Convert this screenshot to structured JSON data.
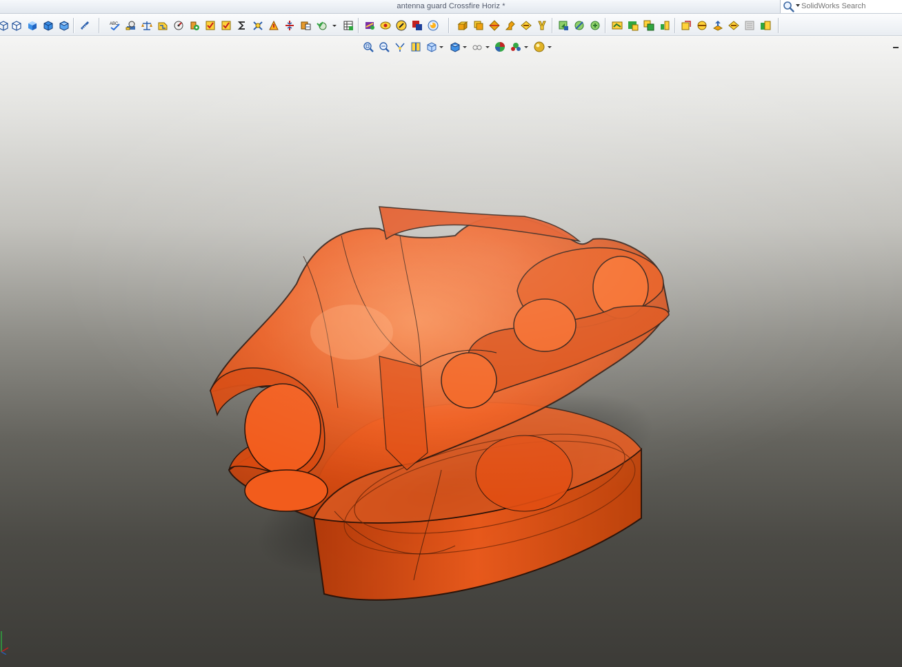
{
  "window": {
    "title": "antenna guard Crossfire Horiz *"
  },
  "search": {
    "placeholder": "SolidWorks Search",
    "icon": "magnifier-icon"
  },
  "colors": {
    "part_orange": "#f05a1a",
    "part_edge": "#2a1208",
    "toolbar_bg": "#eef1f5",
    "viewport_top": "#f5f5f4",
    "viewport_bottom": "#3c3b37"
  },
  "toolbar": {
    "groups": [
      [
        "view-wireframe-icon",
        "view-hidden-lines-icon",
        "view-shaded-icon",
        "view-shaded-edges-icon",
        "view-isometric-icon"
      ],
      [
        "measure-icon"
      ],
      [
        "spell-check-icon",
        "mass-properties-icon",
        "section-properties-icon",
        "check-icon",
        "geometry-analysis-icon",
        "import-diagnostics-icon",
        "deviation-analysis-icon",
        "zebra-stripes-icon",
        "sum-icon",
        "curvature-icon",
        "draft-analysis-icon",
        "undercut-icon",
        "parting-line-icon",
        "thickness-icon",
        "compare-icon"
      ],
      [
        "simulation-icon",
        "rebuild-icon",
        "check-sketch-icon",
        "appearance-icon",
        "realview-icon"
      ],
      [
        "extrude-boss-icon",
        "revolve-icon",
        "sweep-icon",
        "loft-icon",
        "fillet-icon",
        "chamfer-icon"
      ],
      [
        "cut-extrude-icon",
        "cut-revolve-icon",
        "cut-sweep-icon"
      ],
      [
        "plane-icon",
        "axis-icon",
        "coordinate-system-icon",
        "point-icon"
      ],
      [
        "mirror-icon",
        "linear-pattern-icon",
        "circular-pattern-icon",
        "shell-icon",
        "rib-icon",
        "wrap-icon"
      ]
    ]
  },
  "view_toolbar": {
    "items": [
      "zoom-to-fit-icon",
      "zoom-to-area-icon",
      "previous-view-icon",
      "section-view-icon",
      "view-orientation-icon",
      "display-style-icon",
      "hide-show-items-icon",
      "edit-appearance-icon",
      "apply-scene-icon",
      "view-settings-icon"
    ]
  }
}
